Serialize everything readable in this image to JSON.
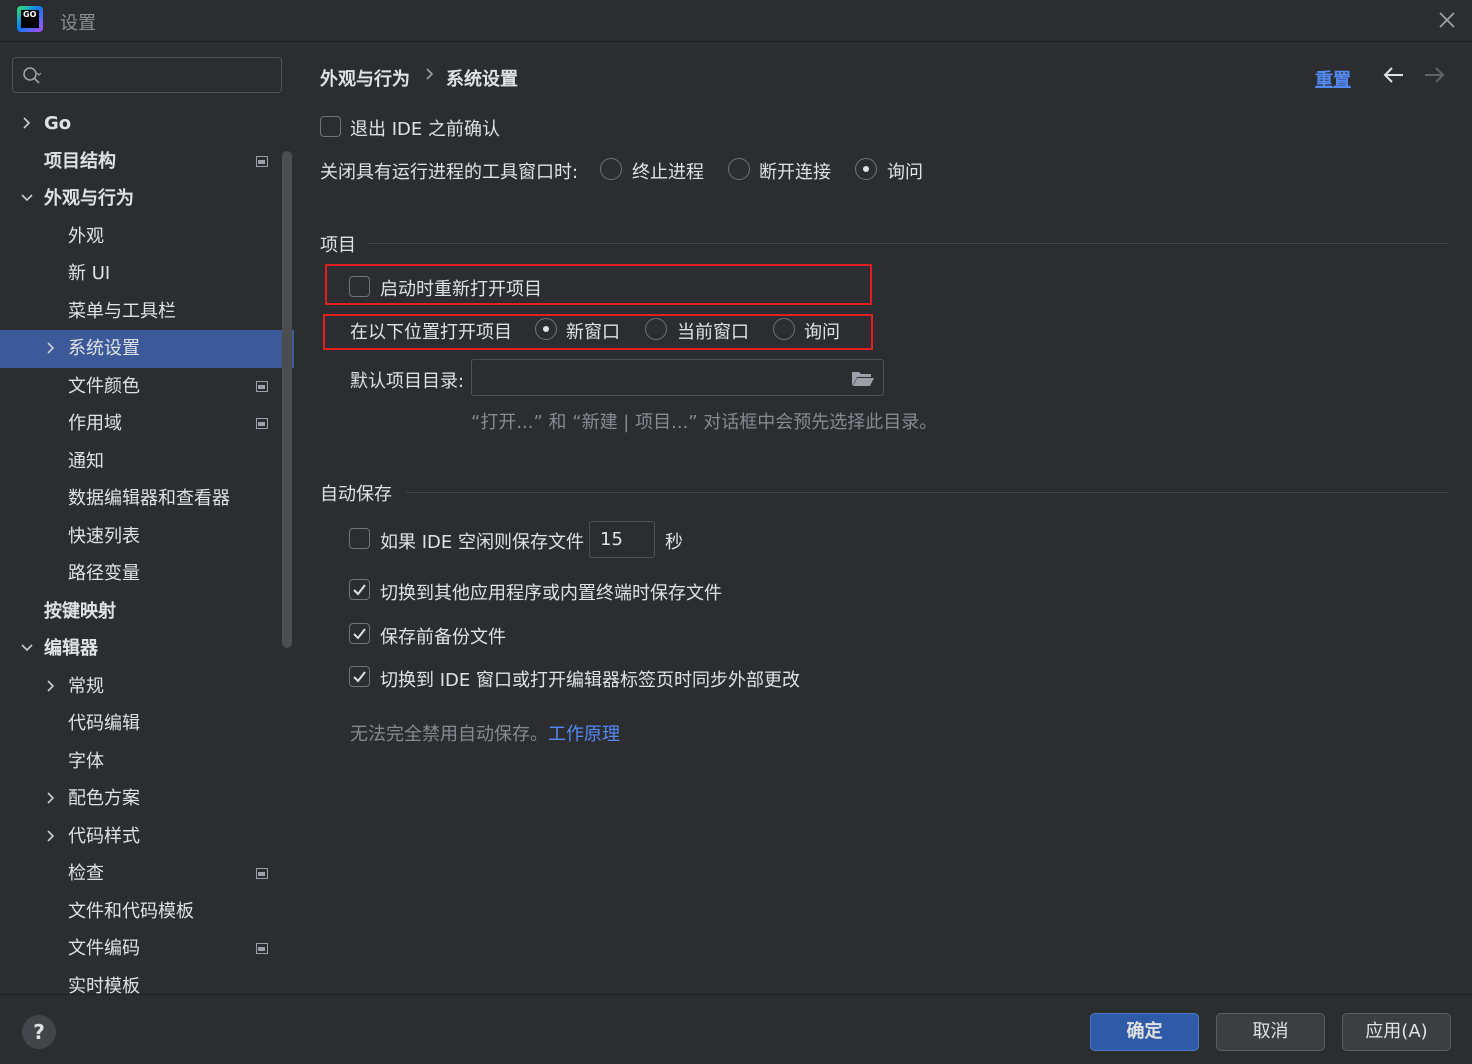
{
  "window": {
    "title": "设置"
  },
  "sidebar": {
    "search_placeholder": "",
    "items": [
      {
        "label": "Go",
        "level": 0,
        "chevron": "right",
        "bold": true,
        "proj": false
      },
      {
        "label": "项目结构",
        "level": 0,
        "chevron": "",
        "bold": true,
        "proj": true
      },
      {
        "label": "外观与行为",
        "level": 0,
        "chevron": "down",
        "bold": true,
        "proj": false
      },
      {
        "label": "外观",
        "level": 1,
        "chevron": "",
        "bold": false,
        "proj": false
      },
      {
        "label": "新 UI",
        "level": 1,
        "chevron": "",
        "bold": false,
        "proj": false
      },
      {
        "label": "菜单与工具栏",
        "level": 1,
        "chevron": "",
        "bold": false,
        "proj": false
      },
      {
        "label": "系统设置",
        "level": 1,
        "chevron": "right",
        "bold": false,
        "proj": false,
        "selected": true
      },
      {
        "label": "文件颜色",
        "level": 1,
        "chevron": "",
        "bold": false,
        "proj": true
      },
      {
        "label": "作用域",
        "level": 1,
        "chevron": "",
        "bold": false,
        "proj": true
      },
      {
        "label": "通知",
        "level": 1,
        "chevron": "",
        "bold": false,
        "proj": false
      },
      {
        "label": "数据编辑器和查看器",
        "level": 1,
        "chevron": "",
        "bold": false,
        "proj": false
      },
      {
        "label": "快速列表",
        "level": 1,
        "chevron": "",
        "bold": false,
        "proj": false
      },
      {
        "label": "路径变量",
        "level": 1,
        "chevron": "",
        "bold": false,
        "proj": false
      },
      {
        "label": "按键映射",
        "level": 0,
        "chevron": "",
        "bold": true,
        "proj": false
      },
      {
        "label": "编辑器",
        "level": 0,
        "chevron": "down",
        "bold": true,
        "proj": false
      },
      {
        "label": "常规",
        "level": 1,
        "chevron": "right",
        "bold": false,
        "proj": false
      },
      {
        "label": "代码编辑",
        "level": 1,
        "chevron": "",
        "bold": false,
        "proj": false
      },
      {
        "label": "字体",
        "level": 1,
        "chevron": "",
        "bold": false,
        "proj": false
      },
      {
        "label": "配色方案",
        "level": 1,
        "chevron": "right",
        "bold": false,
        "proj": false
      },
      {
        "label": "代码样式",
        "level": 1,
        "chevron": "right",
        "bold": false,
        "proj": false
      },
      {
        "label": "检查",
        "level": 1,
        "chevron": "",
        "bold": false,
        "proj": true
      },
      {
        "label": "文件和代码模板",
        "level": 1,
        "chevron": "",
        "bold": false,
        "proj": false
      },
      {
        "label": "文件编码",
        "level": 1,
        "chevron": "",
        "bold": false,
        "proj": true
      },
      {
        "label": "实时模板",
        "level": 1,
        "chevron": "",
        "bold": false,
        "proj": false
      }
    ]
  },
  "header": {
    "breadcrumb_parent": "外观与行为",
    "breadcrumb_current": "系统设置",
    "reset_label": "重置"
  },
  "general": {
    "confirm_exit_label": "退出 IDE 之前确认",
    "confirm_exit_checked": false,
    "close_tool_label": "关闭具有运行进程的工具窗口时:",
    "close_tool_options": [
      "终止进程",
      "断开连接",
      "询问"
    ],
    "close_tool_selected": "询问"
  },
  "project": {
    "section_title": "项目",
    "reopen_label": "启动时重新打开项目",
    "reopen_checked": false,
    "open_location_label": "在以下位置打开项目",
    "open_location_options": [
      "新窗口",
      "当前窗口",
      "询问"
    ],
    "open_location_selected": "新窗口",
    "default_dir_label": "默认项目目录:",
    "default_dir_value": "",
    "default_dir_hint": "“打开...” 和 “新建 | 项目...” 对话框中会预先选择此目录。"
  },
  "autosave": {
    "section_title": "自动保存",
    "idle_label": "如果 IDE 空闲则保存文件",
    "idle_checked": false,
    "idle_seconds": "15",
    "idle_unit": "秒",
    "switch_app_label": "切换到其他应用程序或内置终端时保存文件",
    "switch_app_checked": true,
    "backup_label": "保存前备份文件",
    "backup_checked": true,
    "sync_label": "切换到 IDE 窗口或打开编辑器标签页时同步外部更改",
    "sync_checked": true,
    "note_text": "无法完全禁用自动保存。",
    "note_link": "工作原理"
  },
  "footer": {
    "help_label": "?",
    "ok_label": "确定",
    "cancel_label": "取消",
    "apply_label": "应用(A)"
  }
}
